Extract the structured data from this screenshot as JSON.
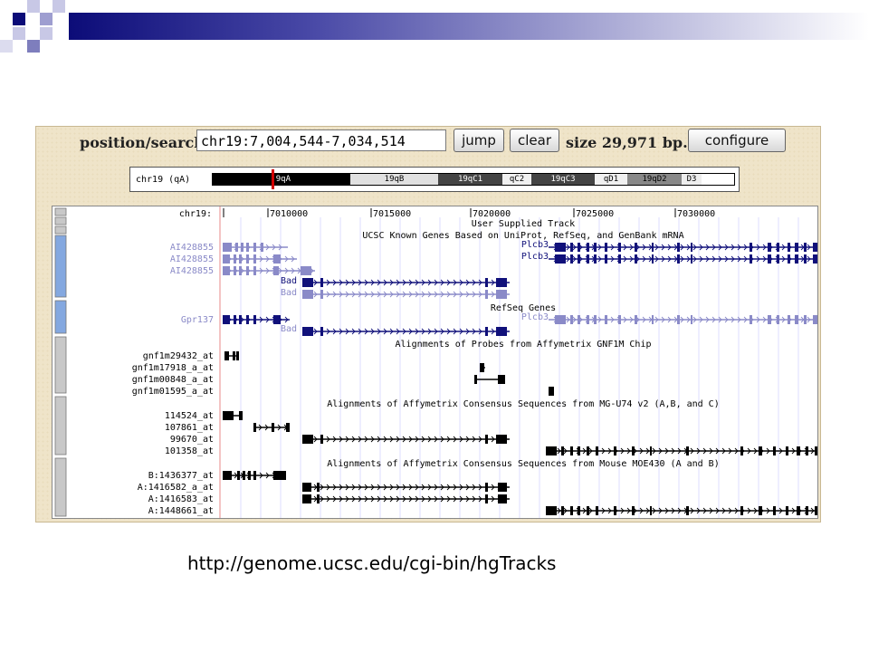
{
  "slide": {
    "url": "http://genome.ucsc.edu/cgi-bin/hgTracks",
    "colors": {
      "header_dark": "#0c0c78",
      "header_mid": "#7e7ebd",
      "header_light": "#c8c8e6"
    }
  },
  "browser": {
    "position_label": "position/search",
    "position_value": "chr19:7,004,544-7,034,514",
    "jump_label": "jump",
    "clear_label": "clear",
    "size_label": "size 29,971 bp.",
    "configure_label": "configure",
    "ideogram": {
      "chrom_label": "chr19 (qA)",
      "bands": [
        "9qA",
        "19qB",
        "19qC1",
        "qC2",
        "19qC3",
        "qD1",
        "19qD2",
        "D3"
      ]
    },
    "ruler": {
      "chrom_label": "chr19:",
      "ticks": [
        "7010000",
        "7015000",
        "7020000",
        "7025000",
        "7030000"
      ]
    },
    "track_titles": [
      "User Supplied Track",
      "UCSC Known Genes Based on UniProt, RefSeq, and GenBank mRNA",
      "RefSeq Genes",
      "Alignments of Probes from Affymetrix GNF1M Chip",
      "Alignments of Affymetrix Consensus Sequences from MG-U74 v2 (A,B, and C)",
      "Alignments of Affymetrix Consensus Sequences from Mouse MOE430 (A and B)"
    ],
    "rows": [
      {
        "label": "AI428855",
        "style": "faint"
      },
      {
        "label": "AI428855",
        "style": "faint"
      },
      {
        "label": "AI428855",
        "style": "faint"
      },
      {
        "label": "",
        "style": "dark"
      },
      {
        "label": "",
        "style": "faint"
      },
      {
        "label": "Gpr137",
        "style": "faint"
      },
      {
        "label": "",
        "style": "dark"
      },
      {
        "label": "gnf1m29432_at",
        "style": "black"
      },
      {
        "label": "gnf1m17918_a_at",
        "style": "black"
      },
      {
        "label": "gnf1m00848_a_at",
        "style": "black"
      },
      {
        "label": "gnf1m01595_a_at",
        "style": "black"
      },
      {
        "label": "114524_at",
        "style": "black"
      },
      {
        "label": "107861_at",
        "style": "black"
      },
      {
        "label": "99670_at",
        "style": "black"
      },
      {
        "label": "101358_at",
        "style": "black"
      },
      {
        "label": "B:1436377_at",
        "style": "black"
      },
      {
        "label": "A:1416582_a_at",
        "style": "black"
      },
      {
        "label": "A:1416583_at",
        "style": "black"
      },
      {
        "label": "A:1448661_at",
        "style": "black"
      }
    ],
    "gene_labels": {
      "bad": "Bad",
      "plcb3": "Plcb3"
    }
  }
}
